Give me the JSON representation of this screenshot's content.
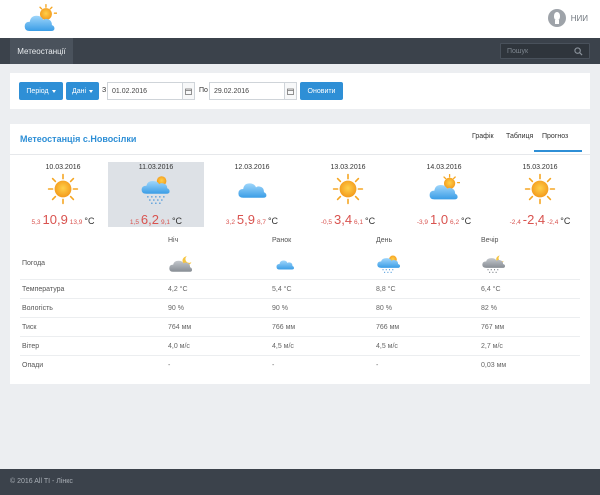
{
  "header": {
    "user_name": "НИИ"
  },
  "nav": {
    "active_tab": "Метеостанції",
    "search_placeholder": "Пошук"
  },
  "filters": {
    "period_label": "Період",
    "data_label": "Дані",
    "from_label": "З",
    "from_value": "01.02.2016",
    "to_label": "По",
    "to_value": "29.02.2016",
    "update_label": "Оновити"
  },
  "station": {
    "title": "Метеостанція с.Новосілки",
    "tabs": [
      "Графік",
      "Таблиця",
      "Прогноз"
    ],
    "active_tab": "Прогноз"
  },
  "days": [
    {
      "date": "10.03.2016",
      "icon": "sun-icon",
      "min": "5,3",
      "main": "10,9",
      "max": "13,9",
      "unit": "°C"
    },
    {
      "date": "11.03.2016",
      "icon": "cloud-snow-sun-icon",
      "min": "1,5",
      "main": "6,2",
      "max": "9,1",
      "unit": "°C"
    },
    {
      "date": "12.03.2016",
      "icon": "cloud-icon",
      "min": "3,2",
      "main": "5,9",
      "max": "8,7",
      "unit": "°C"
    },
    {
      "date": "13.03.2016",
      "icon": "sun-icon",
      "min": "-0,5",
      "main": "3,4",
      "max": "6,1",
      "unit": "°C"
    },
    {
      "date": "14.03.2016",
      "icon": "cloud-sun-icon",
      "min": "-3,9",
      "main": "1,0",
      "max": "6,2",
      "unit": "°C"
    },
    {
      "date": "15.03.2016",
      "icon": "sun-icon",
      "min": "-2,4",
      "main": "-2,4",
      "max": "-2,4",
      "unit": "°C"
    }
  ],
  "periods": [
    "Ніч",
    "Ранок",
    "День",
    "Вечір"
  ],
  "table": {
    "weather_label": "Погода",
    "weather_icons": [
      "cloud-moon-icon",
      "cloud-icon",
      "cloud-sun-snow-icon",
      "cloud-moon-snow-icon"
    ],
    "rows": [
      {
        "label": "Температура",
        "values": [
          "4,2 °C",
          "5,4 °C",
          "8,8 °C",
          "6,4 °C"
        ]
      },
      {
        "label": "Вологість",
        "values": [
          "90 %",
          "90 %",
          "80 %",
          "82 %"
        ]
      },
      {
        "label": "Тиск",
        "values": [
          "764 мм",
          "766 мм",
          "766 мм",
          "767 мм"
        ]
      },
      {
        "label": "Вітер",
        "values": [
          "4,0 м/с",
          "4,5 м/с",
          "4,5 м/с",
          "2,7 м/с"
        ]
      },
      {
        "label": "Опади",
        "values": [
          "-",
          "-",
          "-",
          "0,03 мм"
        ]
      }
    ]
  },
  "footer": {
    "copyright": "© 2016 All TI - Лінкс"
  },
  "colors": {
    "accent": "#2e8fd6",
    "nav_bg": "#3b424b",
    "temp": "#d9534f",
    "sun": "#f5a623",
    "cloud": "#5ab3ee"
  }
}
